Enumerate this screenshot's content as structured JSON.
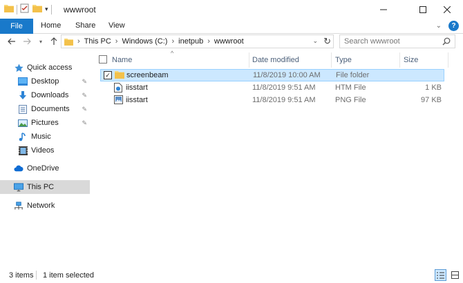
{
  "window": {
    "title": "wwwroot"
  },
  "ribbon": {
    "tabs": [
      {
        "label": "File"
      },
      {
        "label": "Home"
      },
      {
        "label": "Share"
      },
      {
        "label": "View"
      }
    ]
  },
  "address": {
    "crumbs": [
      "This PC",
      "Windows (C:)",
      "inetpub",
      "wwwroot"
    ]
  },
  "search": {
    "placeholder": "Search wwwroot"
  },
  "navpane": {
    "items": [
      {
        "label": "Quick access",
        "icon": "star-icon"
      },
      {
        "label": "Desktop",
        "icon": "desktop-icon"
      },
      {
        "label": "Downloads",
        "icon": "download-icon"
      },
      {
        "label": "Documents",
        "icon": "documents-icon"
      },
      {
        "label": "Pictures",
        "icon": "pictures-icon"
      },
      {
        "label": "Music",
        "icon": "music-icon"
      },
      {
        "label": "Videos",
        "icon": "videos-icon"
      },
      {
        "label": "OneDrive",
        "icon": "cloud-icon"
      },
      {
        "label": "This PC",
        "icon": "computer-icon"
      },
      {
        "label": "Network",
        "icon": "network-icon"
      }
    ]
  },
  "columns": {
    "name": "Name",
    "date": "Date modified",
    "type": "Type",
    "size": "Size"
  },
  "files": [
    {
      "name": "screenbeam",
      "date": "11/8/2019 10:00 AM",
      "type": "File folder",
      "size": "",
      "icon": "folder-icon"
    },
    {
      "name": "iisstart",
      "date": "11/8/2019 9:51 AM",
      "type": "HTM File",
      "size": "1 KB",
      "icon": "htm-file-icon"
    },
    {
      "name": "iisstart",
      "date": "11/8/2019 9:51 AM",
      "type": "PNG File",
      "size": "97 KB",
      "icon": "png-file-icon"
    }
  ],
  "status": {
    "count": "3 items",
    "selection": "1 item selected"
  },
  "colors": {
    "accent": "#1979ca",
    "selection_bg": "#cce8ff",
    "selection_border": "#99d1ff",
    "folder": "#f8d775"
  }
}
